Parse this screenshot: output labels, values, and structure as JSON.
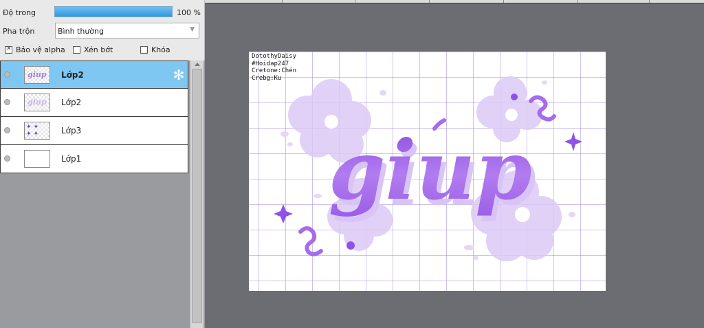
{
  "properties": {
    "opacity_label": "Độ trong",
    "opacity_value": "100 %",
    "opacity_fraction": 1.0,
    "blend_label": "Pha trộn",
    "blend_value": "Bình thường",
    "checks": {
      "alpha_label": "Bảo vệ alpha",
      "alpha_checked": true,
      "clip_label": "Xén bớt",
      "clip_checked": false,
      "lock_label": "Khóa",
      "lock_checked": false
    }
  },
  "layers": [
    {
      "name": "Lớp2",
      "active": true,
      "thumb": "text"
    },
    {
      "name": "Lớp2",
      "active": false,
      "thumb": "text"
    },
    {
      "name": "Lớp3",
      "active": false,
      "thumb": "stars"
    },
    {
      "name": "Lớp1",
      "active": false,
      "thumb": "plain"
    }
  ],
  "canvas": {
    "credits": [
      "DotothyDaisy",
      "#Hoidap247",
      "Cretone:Chén",
      "Crebg:Ku"
    ],
    "artwork_text": "giup"
  },
  "colors": {
    "panel_bg": "#9a9b9e",
    "workspace_bg": "#6b6d72",
    "active_layer": "#7fc7f3",
    "opacity_bar": "#2f98e0",
    "art_purple": "#9b5de5",
    "flower_lilac": "#d9c6f5"
  },
  "icons": {
    "gear": "gear-icon",
    "visibility": "eye-dot-icon",
    "dropdown": "chevron-down-icon"
  }
}
